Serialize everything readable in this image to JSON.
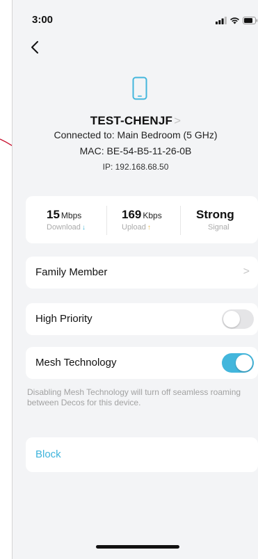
{
  "status_bar": {
    "time": "3:00",
    "icons": [
      "signal-icon",
      "wifi-icon",
      "battery-icon"
    ]
  },
  "header": {
    "back_icon": "chevron-left-icon"
  },
  "device": {
    "icon": "phone-icon",
    "name": "TEST-CHENJF",
    "name_chevron": ">",
    "connected_to": "Connected to: Main Bedroom (5 GHz)",
    "mac": "MAC: BE-54-B5-11-26-0B",
    "ip": "IP: 192.168.68.50"
  },
  "stats": [
    {
      "value": "15",
      "unit": "Mbps",
      "label": "Download",
      "arrow": "↓"
    },
    {
      "value": "169",
      "unit": "Kbps",
      "label": "Upload",
      "arrow": "↑"
    },
    {
      "value": "Strong",
      "unit": "",
      "label": "Signal",
      "arrow": ""
    }
  ],
  "settings": {
    "family_member": {
      "label": "Family Member",
      "chevron": ">"
    },
    "high_priority": {
      "label": "High Priority",
      "enabled": false
    },
    "mesh_technology": {
      "label": "Mesh Technology",
      "enabled": true
    },
    "mesh_note": "Disabling Mesh Technology will turn off seamless roaming between Decos for this device.",
    "block": {
      "label": "Block"
    }
  },
  "colors": {
    "accent": "#43b6dc",
    "background": "#f3f4f6",
    "annotation_arrow": "#c8102e",
    "download_arrow": "#45b5d8",
    "upload_arrow": "#e8b84a"
  }
}
